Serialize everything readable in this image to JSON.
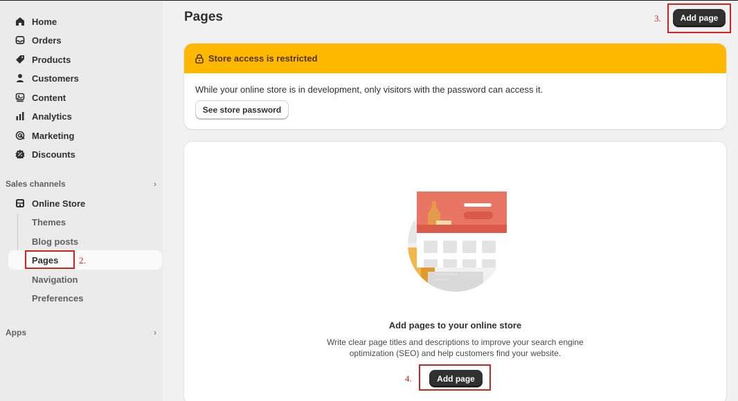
{
  "sidebar": {
    "items": [
      {
        "label": "Home",
        "icon": "home-icon"
      },
      {
        "label": "Orders",
        "icon": "inbox-icon"
      },
      {
        "label": "Products",
        "icon": "tag-icon"
      },
      {
        "label": "Customers",
        "icon": "person-icon"
      },
      {
        "label": "Content",
        "icon": "content-icon"
      },
      {
        "label": "Analytics",
        "icon": "bar-chart-icon"
      },
      {
        "label": "Marketing",
        "icon": "target-icon"
      },
      {
        "label": "Discounts",
        "icon": "discount-icon"
      }
    ],
    "sales_channels": {
      "label": "Sales channels"
    },
    "online_store": {
      "label": "Online Store",
      "icon": "store-icon",
      "subitems": [
        "Themes",
        "Blog posts",
        "Pages",
        "Navigation",
        "Preferences"
      ]
    },
    "apps": {
      "label": "Apps"
    }
  },
  "main": {
    "title": "Pages",
    "add_page_label": "Add page",
    "banner": {
      "title": "Store access is restricted",
      "text": "While your online store is in development, only visitors with the password can access it.",
      "button_label": "See store password",
      "color": "#ffb800"
    },
    "empty_state": {
      "title": "Add pages to your online store",
      "description": "Write clear page titles and descriptions to improve your search engine optimization (SEO) and help customers find your website.",
      "button_label": "Add page"
    }
  },
  "annotations": {
    "step2": "2.",
    "step3": "3.",
    "step4": "4.",
    "color": "#d61f1f"
  }
}
